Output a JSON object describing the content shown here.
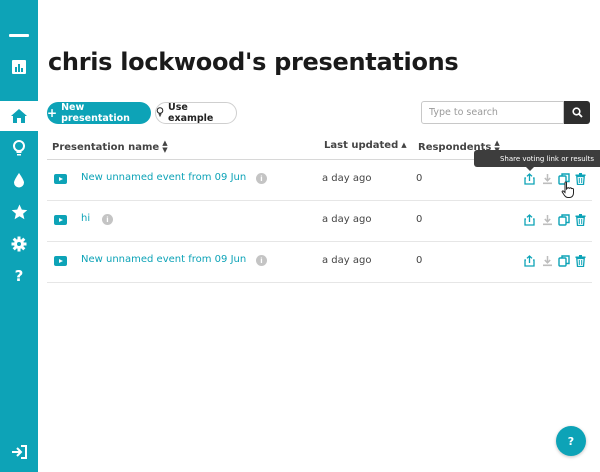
{
  "sidebar": {
    "logo_icon": "presentation-chart-icon",
    "items": [
      {
        "icon": "home-icon",
        "active": true
      },
      {
        "icon": "lightbulb-icon",
        "active": false
      },
      {
        "icon": "drop-icon",
        "active": false
      },
      {
        "icon": "star-icon",
        "active": false
      },
      {
        "icon": "gear-icon",
        "active": false
      },
      {
        "icon": "question-icon",
        "label": "?",
        "active": false
      }
    ],
    "logout_icon": "logout-icon"
  },
  "page": {
    "title": "chris lockwood's presentations"
  },
  "toolbar": {
    "new_presentation_label": "New presentation",
    "use_example_label": "Use example",
    "search_placeholder": "Type to search"
  },
  "table": {
    "columns": {
      "name": "Presentation name",
      "last_updated": "Last updated",
      "respondents": "Respondents"
    },
    "rows": [
      {
        "name": "New unnamed event from 09 Jun",
        "last_updated": "a day ago",
        "respondents": "0",
        "info": "i"
      },
      {
        "name": "hi",
        "last_updated": "a day ago",
        "respondents": "0",
        "info": "i"
      },
      {
        "name": "New unnamed event from 09 Jun",
        "last_updated": "a day ago",
        "respondents": "0",
        "info": "i"
      }
    ]
  },
  "tooltip": {
    "text": "Share voting link or results"
  },
  "help_button_label": "?",
  "colors": {
    "accent": "#0da3b7",
    "dark": "#2e2e2e"
  }
}
